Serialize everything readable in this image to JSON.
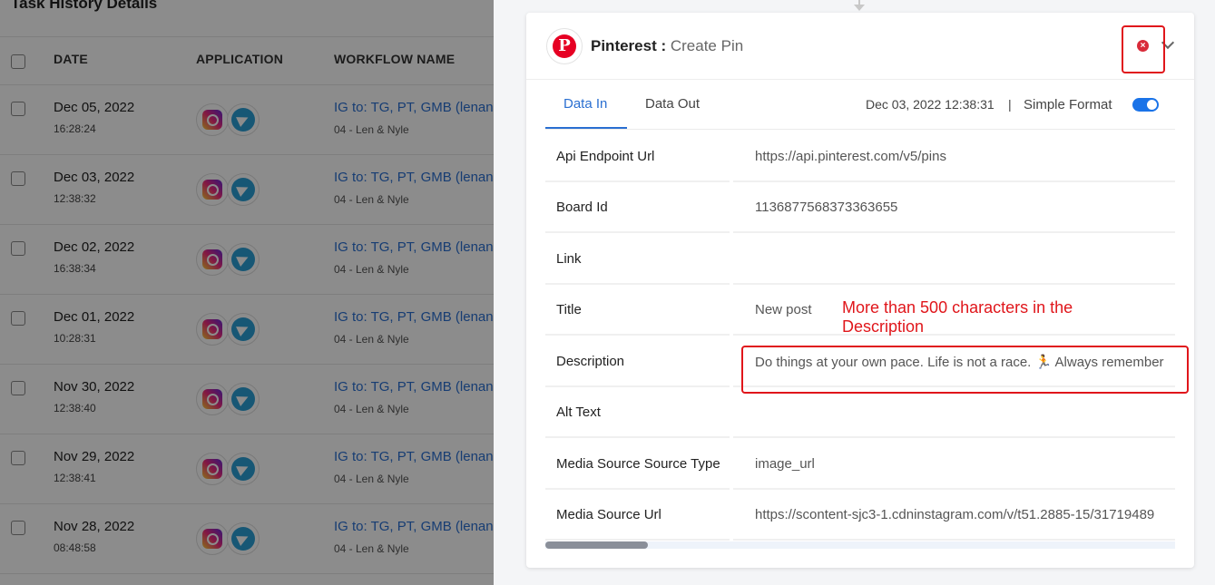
{
  "history": {
    "title": "Task History Details",
    "columns": {
      "date": "DATE",
      "application": "APPLICATION",
      "workflow": "WORKFLOW NAME"
    },
    "rows": [
      {
        "date": "Dec 05, 2022",
        "time": "16:28:24",
        "workflow": "IG to: TG, PT, GMB (lenanc",
        "sub": "04 - Len & Nyle"
      },
      {
        "date": "Dec 03, 2022",
        "time": "12:38:32",
        "workflow": "IG to: TG, PT, GMB (lenanc",
        "sub": "04 - Len & Nyle"
      },
      {
        "date": "Dec 02, 2022",
        "time": "16:38:34",
        "workflow": "IG to: TG, PT, GMB (lenanc",
        "sub": "04 - Len & Nyle"
      },
      {
        "date": "Dec 01, 2022",
        "time": "10:28:31",
        "workflow": "IG to: TG, PT, GMB (lenanc",
        "sub": "04 - Len & Nyle"
      },
      {
        "date": "Nov 30, 2022",
        "time": "12:38:40",
        "workflow": "IG to: TG, PT, GMB (lenanc",
        "sub": "04 - Len & Nyle"
      },
      {
        "date": "Nov 29, 2022",
        "time": "12:38:41",
        "workflow": "IG to: TG, PT, GMB (lenanc",
        "sub": "04 - Len & Nyle"
      },
      {
        "date": "Nov 28, 2022",
        "time": "08:48:58",
        "workflow": "IG to: TG, PT, GMB (lenanc",
        "sub": "04 - Len & Nyle"
      }
    ]
  },
  "detail": {
    "app_name": "Pinterest :",
    "action": " Create Pin",
    "tabs": {
      "data_in": "Data In",
      "data_out": "Data Out"
    },
    "timestamp": "Dec 03, 2022 12:38:31",
    "separator": "|",
    "format_label": "Simple Format",
    "fields": [
      {
        "label": "Api Endpoint Url",
        "value": "https://api.pinterest.com/v5/pins"
      },
      {
        "label": "Board Id",
        "value": "1136877568373363655"
      },
      {
        "label": "Link",
        "value": ""
      },
      {
        "label": "Title",
        "value": "New post"
      },
      {
        "label": "Description",
        "value": "Do things at your own pace. Life is not a race. 🏃 Always remember"
      },
      {
        "label": "Alt Text",
        "value": ""
      },
      {
        "label": "Media Source Source Type",
        "value": "image_url"
      },
      {
        "label": "Media Source Url",
        "value": "https://scontent-sjc3-1.cdninstagram.com/v/t51.2885-15/31719489"
      }
    ]
  },
  "annotation": {
    "note": "More  than 500 characters in the Description"
  },
  "colors": {
    "accent": "#2a6fd1",
    "pinterest": "#e60023",
    "annotation": "#e0161b",
    "toggle": "#1a73e8"
  },
  "icons": {
    "pinterest": "pinterest-logo-icon",
    "instagram": "instagram-icon",
    "telegram": "telegram-icon",
    "close": "close-circle-icon",
    "chevron": "chevron-down-icon"
  }
}
